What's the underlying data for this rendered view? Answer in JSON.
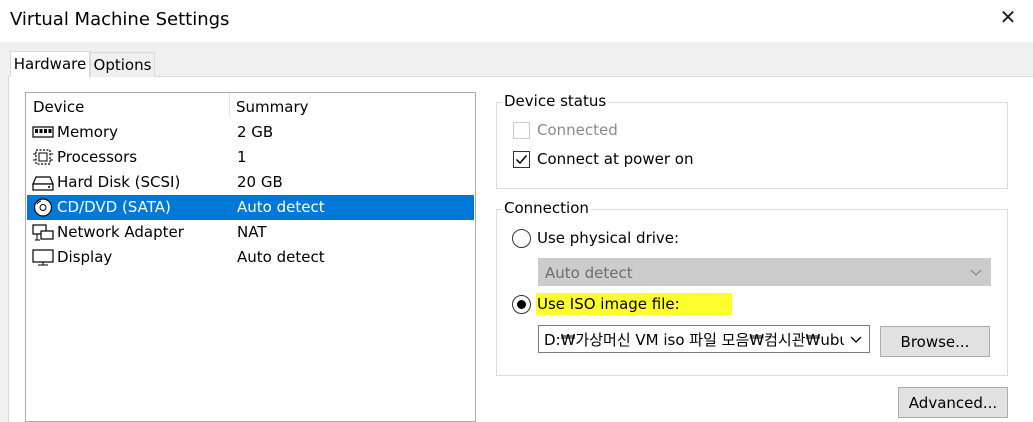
{
  "window": {
    "title": "Virtual Machine Settings",
    "close_glyph": "✕"
  },
  "tabs": [
    {
      "label": "Hardware",
      "active": true
    },
    {
      "label": "Options",
      "active": false
    }
  ],
  "device_list": {
    "columns": {
      "device": "Device",
      "summary": "Summary"
    },
    "rows": [
      {
        "name": "Memory",
        "summary": "2 GB",
        "icon": "memory-icon",
        "selected": false
      },
      {
        "name": "Processors",
        "summary": "1",
        "icon": "processor-icon",
        "selected": false
      },
      {
        "name": "Hard Disk (SCSI)",
        "summary": "20 GB",
        "icon": "hard-disk-icon",
        "selected": false
      },
      {
        "name": "CD/DVD (SATA)",
        "summary": "Auto detect",
        "icon": "cd-dvd-icon",
        "selected": true
      },
      {
        "name": "Network Adapter",
        "summary": "NAT",
        "icon": "network-adapter-icon",
        "selected": false
      },
      {
        "name": "Display",
        "summary": "Auto detect",
        "icon": "display-icon",
        "selected": false
      }
    ],
    "selection_color": "#0078d7"
  },
  "device_status": {
    "title": "Device status",
    "connected": {
      "label": "Connected",
      "checked": false,
      "enabled": false
    },
    "connect_at_power_on": {
      "label": "Connect at power on",
      "checked": true,
      "enabled": true
    }
  },
  "connection": {
    "title": "Connection",
    "physical": {
      "label": "Use physical drive:",
      "selected": false
    },
    "physical_drive_value": "Auto detect",
    "iso": {
      "label": "Use ISO image file:",
      "selected": true
    },
    "iso_path": "D:₩가상머신 VM iso 파일 모음₩컴시관₩ubu",
    "browse_label": "Browse...",
    "highlight_color": "#ffff2e"
  },
  "advanced_label": "Advanced..."
}
